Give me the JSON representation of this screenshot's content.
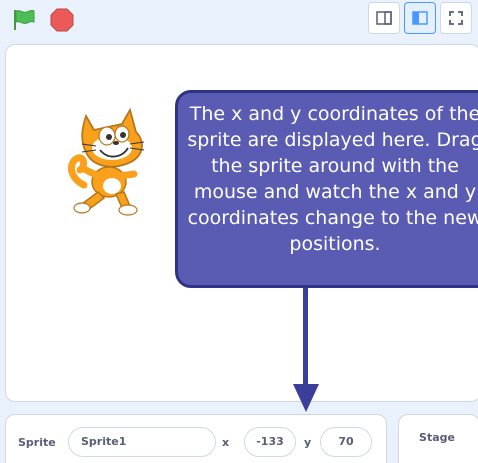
{
  "toolbar": {
    "green_flag_icon": "green-flag-icon",
    "stop_icon": "stop-icon",
    "layout_buttons": [
      {
        "icon": "small-stage-icon"
      },
      {
        "icon": "large-stage-icon"
      },
      {
        "icon": "fullscreen-icon"
      }
    ]
  },
  "stage": {
    "sprite_icon": "scratch-cat",
    "callout_text": "The x and y coordinates of the sprite are displayed here. Drag the sprite around with the mouse and watch the x and y coordinates change to the new positions."
  },
  "sprite_info": {
    "sprite_label": "Sprite",
    "sprite_name": "Sprite1",
    "x_label": "x",
    "x_value": "-133",
    "y_label": "y",
    "y_value": "70"
  },
  "stage_selector": {
    "label": "Stage"
  },
  "colors": {
    "background": "#e9f1fc",
    "callout_fill": "#5a5bb2",
    "callout_border": "#2f3388",
    "text_gray": "#575e75",
    "flag_green": "#4cbf56",
    "stop_red": "#ec5959"
  }
}
